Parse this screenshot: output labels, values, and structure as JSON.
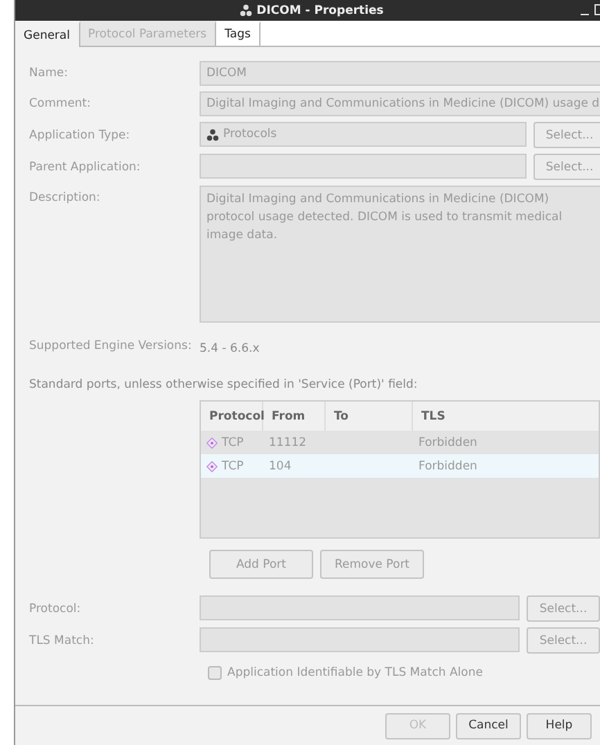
{
  "window": {
    "title": "DICOM - Properties"
  },
  "tabs": [
    {
      "label": "General",
      "selected": true,
      "disabled": false
    },
    {
      "label": "Protocol Parameters",
      "selected": false,
      "disabled": true
    },
    {
      "label": "Tags",
      "selected": false,
      "disabled": false
    }
  ],
  "fields": [
    {
      "kind": "text",
      "label": "Name:",
      "value": "DICOM"
    },
    {
      "kind": "text",
      "label": "Comment:",
      "value": "Digital Imaging and Communications in Medicine (DICOM) usage d"
    },
    {
      "kind": "select",
      "label": "Application Type:",
      "value": "Protocols",
      "button": "Select..."
    },
    {
      "kind": "select",
      "label": "Parent Application:",
      "button": "Select..."
    },
    {
      "kind": "area",
      "label": "Description:",
      "value": "Digital Imaging and Communications in Medicine (DICOM) protocol usage detected. DICOM is used to transmit medical image data."
    },
    {
      "kind": "plain",
      "label": "Supported Engine Versions:",
      "value": "5.4 - 6.6.x"
    }
  ],
  "ports_note": "Standard ports, unless otherwise specified in 'Service (Port)' field:",
  "table": {
    "columns": [
      "Protocol",
      "From",
      "To",
      "TLS"
    ],
    "rows": [
      {
        "cells": [
          "TCP",
          "11112",
          "",
          "Forbidden"
        ],
        "selected": false
      },
      {
        "cells": [
          "TCP",
          "104",
          "",
          "Forbidden"
        ],
        "selected": true
      }
    ]
  },
  "port_buttons": [
    {
      "label": "Add Port"
    },
    {
      "label": "Remove Port"
    }
  ],
  "fields2": [
    {
      "kind": "select",
      "label": "Protocol:",
      "button": "Select..."
    },
    {
      "kind": "select",
      "label": "TLS Match:",
      "button": "Select..."
    }
  ],
  "checkbox": {
    "label": "Application Identifiable by TLS Match Alone",
    "checked": false
  },
  "buttons": [
    {
      "label": "OK",
      "disabled": true
    },
    {
      "label": "Cancel",
      "disabled": false
    },
    {
      "label": "Help",
      "disabled": false
    }
  ]
}
